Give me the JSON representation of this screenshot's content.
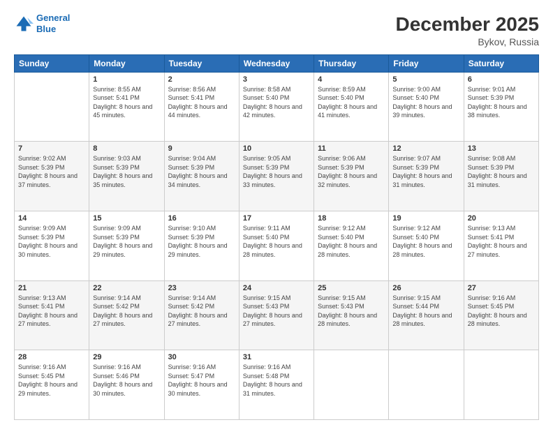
{
  "logo": {
    "line1": "General",
    "line2": "Blue"
  },
  "title": "December 2025",
  "subtitle": "Bykov, Russia",
  "headers": [
    "Sunday",
    "Monday",
    "Tuesday",
    "Wednesday",
    "Thursday",
    "Friday",
    "Saturday"
  ],
  "weeks": [
    [
      {
        "day": "",
        "sunrise": "",
        "sunset": "",
        "daylight": ""
      },
      {
        "day": "1",
        "sunrise": "Sunrise: 8:55 AM",
        "sunset": "Sunset: 5:41 PM",
        "daylight": "Daylight: 8 hours and 45 minutes."
      },
      {
        "day": "2",
        "sunrise": "Sunrise: 8:56 AM",
        "sunset": "Sunset: 5:41 PM",
        "daylight": "Daylight: 8 hours and 44 minutes."
      },
      {
        "day": "3",
        "sunrise": "Sunrise: 8:58 AM",
        "sunset": "Sunset: 5:40 PM",
        "daylight": "Daylight: 8 hours and 42 minutes."
      },
      {
        "day": "4",
        "sunrise": "Sunrise: 8:59 AM",
        "sunset": "Sunset: 5:40 PM",
        "daylight": "Daylight: 8 hours and 41 minutes."
      },
      {
        "day": "5",
        "sunrise": "Sunrise: 9:00 AM",
        "sunset": "Sunset: 5:40 PM",
        "daylight": "Daylight: 8 hours and 39 minutes."
      },
      {
        "day": "6",
        "sunrise": "Sunrise: 9:01 AM",
        "sunset": "Sunset: 5:39 PM",
        "daylight": "Daylight: 8 hours and 38 minutes."
      }
    ],
    [
      {
        "day": "7",
        "sunrise": "Sunrise: 9:02 AM",
        "sunset": "Sunset: 5:39 PM",
        "daylight": "Daylight: 8 hours and 37 minutes."
      },
      {
        "day": "8",
        "sunrise": "Sunrise: 9:03 AM",
        "sunset": "Sunset: 5:39 PM",
        "daylight": "Daylight: 8 hours and 35 minutes."
      },
      {
        "day": "9",
        "sunrise": "Sunrise: 9:04 AM",
        "sunset": "Sunset: 5:39 PM",
        "daylight": "Daylight: 8 hours and 34 minutes."
      },
      {
        "day": "10",
        "sunrise": "Sunrise: 9:05 AM",
        "sunset": "Sunset: 5:39 PM",
        "daylight": "Daylight: 8 hours and 33 minutes."
      },
      {
        "day": "11",
        "sunrise": "Sunrise: 9:06 AM",
        "sunset": "Sunset: 5:39 PM",
        "daylight": "Daylight: 8 hours and 32 minutes."
      },
      {
        "day": "12",
        "sunrise": "Sunrise: 9:07 AM",
        "sunset": "Sunset: 5:39 PM",
        "daylight": "Daylight: 8 hours and 31 minutes."
      },
      {
        "day": "13",
        "sunrise": "Sunrise: 9:08 AM",
        "sunset": "Sunset: 5:39 PM",
        "daylight": "Daylight: 8 hours and 31 minutes."
      }
    ],
    [
      {
        "day": "14",
        "sunrise": "Sunrise: 9:09 AM",
        "sunset": "Sunset: 5:39 PM",
        "daylight": "Daylight: 8 hours and 30 minutes."
      },
      {
        "day": "15",
        "sunrise": "Sunrise: 9:09 AM",
        "sunset": "Sunset: 5:39 PM",
        "daylight": "Daylight: 8 hours and 29 minutes."
      },
      {
        "day": "16",
        "sunrise": "Sunrise: 9:10 AM",
        "sunset": "Sunset: 5:39 PM",
        "daylight": "Daylight: 8 hours and 29 minutes."
      },
      {
        "day": "17",
        "sunrise": "Sunrise: 9:11 AM",
        "sunset": "Sunset: 5:40 PM",
        "daylight": "Daylight: 8 hours and 28 minutes."
      },
      {
        "day": "18",
        "sunrise": "Sunrise: 9:12 AM",
        "sunset": "Sunset: 5:40 PM",
        "daylight": "Daylight: 8 hours and 28 minutes."
      },
      {
        "day": "19",
        "sunrise": "Sunrise: 9:12 AM",
        "sunset": "Sunset: 5:40 PM",
        "daylight": "Daylight: 8 hours and 28 minutes."
      },
      {
        "day": "20",
        "sunrise": "Sunrise: 9:13 AM",
        "sunset": "Sunset: 5:41 PM",
        "daylight": "Daylight: 8 hours and 27 minutes."
      }
    ],
    [
      {
        "day": "21",
        "sunrise": "Sunrise: 9:13 AM",
        "sunset": "Sunset: 5:41 PM",
        "daylight": "Daylight: 8 hours and 27 minutes."
      },
      {
        "day": "22",
        "sunrise": "Sunrise: 9:14 AM",
        "sunset": "Sunset: 5:42 PM",
        "daylight": "Daylight: 8 hours and 27 minutes."
      },
      {
        "day": "23",
        "sunrise": "Sunrise: 9:14 AM",
        "sunset": "Sunset: 5:42 PM",
        "daylight": "Daylight: 8 hours and 27 minutes."
      },
      {
        "day": "24",
        "sunrise": "Sunrise: 9:15 AM",
        "sunset": "Sunset: 5:43 PM",
        "daylight": "Daylight: 8 hours and 27 minutes."
      },
      {
        "day": "25",
        "sunrise": "Sunrise: 9:15 AM",
        "sunset": "Sunset: 5:43 PM",
        "daylight": "Daylight: 8 hours and 28 minutes."
      },
      {
        "day": "26",
        "sunrise": "Sunrise: 9:15 AM",
        "sunset": "Sunset: 5:44 PM",
        "daylight": "Daylight: 8 hours and 28 minutes."
      },
      {
        "day": "27",
        "sunrise": "Sunrise: 9:16 AM",
        "sunset": "Sunset: 5:45 PM",
        "daylight": "Daylight: 8 hours and 28 minutes."
      }
    ],
    [
      {
        "day": "28",
        "sunrise": "Sunrise: 9:16 AM",
        "sunset": "Sunset: 5:45 PM",
        "daylight": "Daylight: 8 hours and 29 minutes."
      },
      {
        "day": "29",
        "sunrise": "Sunrise: 9:16 AM",
        "sunset": "Sunset: 5:46 PM",
        "daylight": "Daylight: 8 hours and 30 minutes."
      },
      {
        "day": "30",
        "sunrise": "Sunrise: 9:16 AM",
        "sunset": "Sunset: 5:47 PM",
        "daylight": "Daylight: 8 hours and 30 minutes."
      },
      {
        "day": "31",
        "sunrise": "Sunrise: 9:16 AM",
        "sunset": "Sunset: 5:48 PM",
        "daylight": "Daylight: 8 hours and 31 minutes."
      },
      {
        "day": "",
        "sunrise": "",
        "sunset": "",
        "daylight": ""
      },
      {
        "day": "",
        "sunrise": "",
        "sunset": "",
        "daylight": ""
      },
      {
        "day": "",
        "sunrise": "",
        "sunset": "",
        "daylight": ""
      }
    ]
  ]
}
